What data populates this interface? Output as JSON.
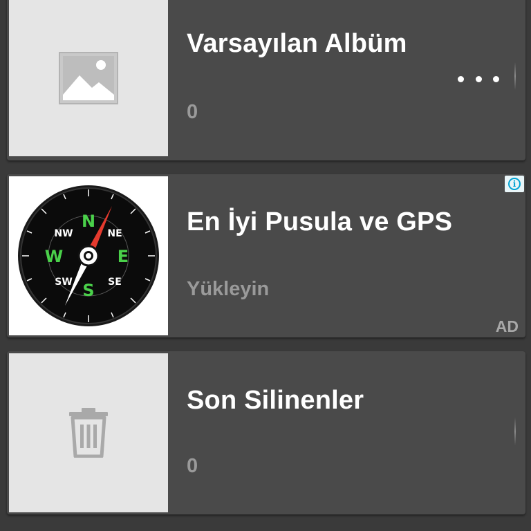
{
  "albums": [
    {
      "title": "Varsayılan Albüm",
      "count": "0",
      "thumbnail_icon": "image-placeholder-icon",
      "more_icon": "more-horizontal-icon"
    },
    {
      "title": "Son Silinenler",
      "count": "0",
      "thumbnail_icon": "trash-icon"
    }
  ],
  "ad": {
    "title": "En İyi Pusula ve GPS",
    "cta": "Yükleyin",
    "label": "AD",
    "info_glyph": "i",
    "info_icon": "info-icon",
    "image_icon": "compass-icon"
  },
  "colors": {
    "background": "#3a3a3a",
    "card": "#4a4a4a",
    "accent_info": "#00a3d3"
  }
}
